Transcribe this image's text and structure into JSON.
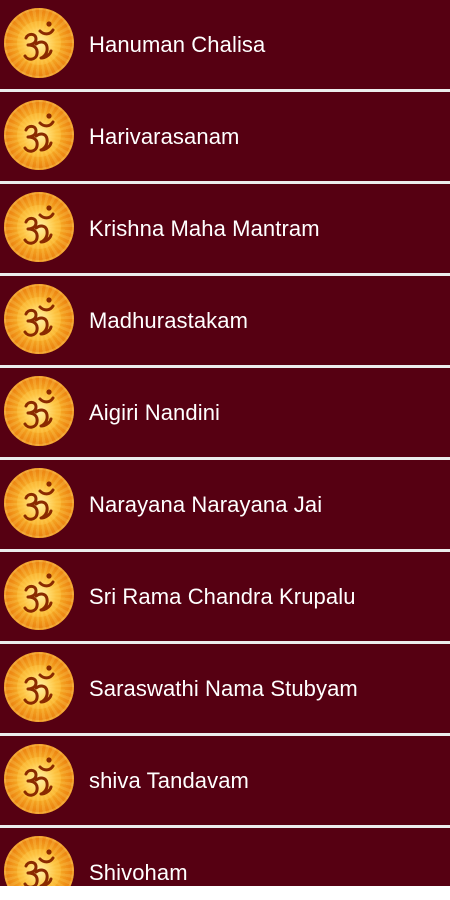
{
  "theme": {
    "row_background": "#560012",
    "divider": "#ececec",
    "text_color": "#ffffff",
    "icon_accent": "#f6a623"
  },
  "list": {
    "icon": "om-symbol-icon",
    "items": [
      {
        "label": "Hanuman Chalisa"
      },
      {
        "label": "Harivarasanam"
      },
      {
        "label": "Krishna Maha Mantram"
      },
      {
        "label": "Madhurastakam"
      },
      {
        "label": "Aigiri Nandini"
      },
      {
        "label": "Narayana Narayana Jai"
      },
      {
        "label": "Sri Rama Chandra Krupalu"
      },
      {
        "label": "Saraswathi Nama Stubyam"
      },
      {
        "label": "shiva Tandavam"
      },
      {
        "label": "Shivoham"
      }
    ]
  }
}
